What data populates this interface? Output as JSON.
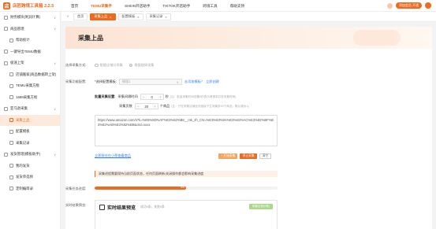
{
  "app": {
    "name": "店匠跨境工具箱 2.2.5",
    "logo_glyph": "店"
  },
  "top_nav": [
    {
      "label": "首页",
      "active": false
    },
    {
      "label": "TEMU采集手",
      "active": true
    },
    {
      "label": "SHEIN开店助手",
      "active": false
    },
    {
      "label": "TIKTOK开店助手",
      "active": false
    },
    {
      "label": "跨境工具",
      "active": false
    },
    {
      "label": "帮助支持",
      "active": false
    }
  ],
  "top_right": {
    "vip_label": "添加会员 开通"
  },
  "sidebar": [
    {
      "label": "财务模块(利润计算)",
      "sub": false,
      "active": false,
      "caret": "∨"
    },
    {
      "label": "商品管理",
      "sub": false,
      "active": false,
      "caret": "∨"
    },
    {
      "label": "帮助统计",
      "sub": true,
      "active": false,
      "caret": ""
    },
    {
      "label": "一键导出TEMU数据",
      "sub": false,
      "active": false,
      "caret": ""
    },
    {
      "label": "极速上架",
      "sub": false,
      "active": false,
      "caret": "∨"
    },
    {
      "label": "店铺搬家(商品数据转上架)",
      "sub": true,
      "active": false,
      "caret": ""
    },
    {
      "label": "TEMU采集方框",
      "sub": true,
      "active": false,
      "caret": ""
    },
    {
      "label": "1688采集方框",
      "sub": true,
      "active": false,
      "caret": ""
    },
    {
      "label": "亚马逊采集",
      "sub": false,
      "active": false,
      "caret": "∨"
    },
    {
      "label": "采集上品",
      "sub": true,
      "active": true,
      "caret": ""
    },
    {
      "label": "配置模板",
      "sub": true,
      "active": false,
      "caret": ""
    },
    {
      "label": "采集记录",
      "sub": true,
      "active": false,
      "caret": ""
    },
    {
      "label": "发货管理(模板助手)",
      "sub": false,
      "active": false,
      "caret": "∨"
    },
    {
      "label": "我的发货",
      "sub": true,
      "active": false,
      "caret": ""
    },
    {
      "label": "发货单选择",
      "sub": true,
      "active": false,
      "caret": ""
    },
    {
      "label": "定制编目录",
      "sub": true,
      "active": false,
      "caret": ""
    }
  ],
  "tabs": [
    {
      "label": "首页",
      "active": false,
      "closable": false
    },
    {
      "label": "采集上品",
      "active": true,
      "closable": true
    },
    {
      "label": "配置模板",
      "active": false,
      "closable": true
    },
    {
      "label": "采集记录",
      "active": false,
      "closable": true
    }
  ],
  "page": {
    "title": "采集上品",
    "method_label": "选择采集方式:",
    "method_options": [
      {
        "label": "根据店铺分采集",
        "selected": false
      },
      {
        "label": "根据链接采集",
        "selected": true
      }
    ],
    "template_label": "采集功能配置:",
    "template_required": "*选择配置模板:",
    "template_select": "模版1",
    "template_link1": "去添加模板？",
    "template_link2": "立即创建",
    "batch_label": "批量采集设置:",
    "interval_label": "采集间隔时间",
    "interval_value": "0",
    "interval_unit": "秒",
    "interval_note": "(注：批量采集时间设置0秒表示请请求并发采集时间)",
    "pages_label": "采集页数",
    "pages_value": "20",
    "pages_unit": "个商品",
    "pages_note": "(注：只在采集店铺全页链接下生效最多20个商品，默认值为1)",
    "url_text": "https://www.amazon.com/s?k=%E5%8D%AF%E3%82%B8__mk_zh_CN=%E3%83%9A%E3%83%AC%E3%82%BF%E3%82%AB%E3%82%B9&crid=xxxx",
    "url_text_display": "https://www.amazon.com/s?k=%E5%8D%AF%E3%82%B8__mk_zh_CN=%E3%83%9A%E3%83%AC%E3%82%BF%E3%82%AB%E3%82%B9&crid=xxxx",
    "helper_link": "立即前往在小帮查看商品",
    "btn_start": "+ 开始采集",
    "btn_stop": "停止采集",
    "btn_clear": "清空",
    "notice": "采集进程需要保持当前页面状态，任何页面刷新/关闭操作都会影响采集进度",
    "progress_label": "采集任务进度:",
    "progress_value": 0.5,
    "progress_text": "5%",
    "preview_label": "实时结果预览:",
    "preview_title": "实时结果预览",
    "preview_sub": "成功0条，失败0条",
    "preview_btn": "采集记录(0条)"
  },
  "colors": {
    "accent": "#ef6a1e",
    "link": "#2d7ff9"
  }
}
